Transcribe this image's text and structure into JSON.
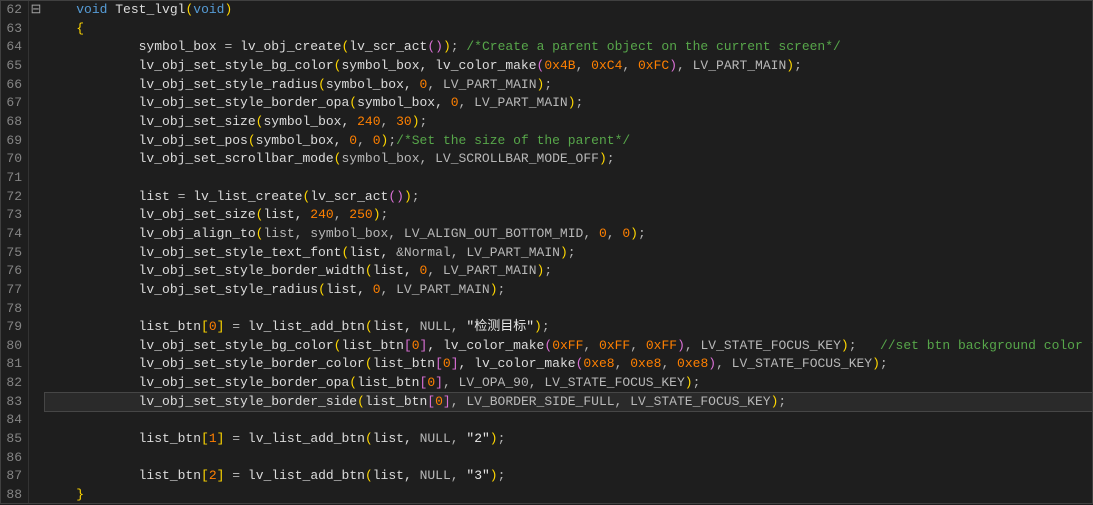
{
  "gutter": {
    "start": 62,
    "end": 88
  },
  "fold": {
    "marker_line": 62,
    "marker": "⊟"
  },
  "highlight_line": 83,
  "code_lines": [
    {
      "n": 62,
      "indent": 1,
      "tokens": [
        {
          "t": "void",
          "c": "kw"
        },
        {
          "t": " Test_lvgl",
          "c": "fn"
        },
        {
          "t": "(",
          "c": "p"
        },
        {
          "t": "void",
          "c": "kw"
        },
        {
          "t": ")",
          "c": "p"
        }
      ]
    },
    {
      "n": 63,
      "indent": 1,
      "tokens": [
        {
          "t": "{",
          "c": "p"
        }
      ]
    },
    {
      "n": 64,
      "indent": 3,
      "tokens": [
        {
          "t": "symbol_box ",
          "c": "id"
        },
        {
          "t": "=",
          "c": "op"
        },
        {
          "t": " lv_obj_create",
          "c": "fn"
        },
        {
          "t": "(",
          "c": "p"
        },
        {
          "t": "lv_scr_act",
          "c": "fn"
        },
        {
          "t": "(",
          "c": "p2"
        },
        {
          "t": ")",
          "c": "p2"
        },
        {
          "t": ")",
          "c": "p"
        },
        {
          "t": "; ",
          "c": "op"
        },
        {
          "t": "/*Create a parent object on the current screen*/",
          "c": "cmt"
        }
      ]
    },
    {
      "n": 65,
      "indent": 3,
      "tokens": [
        {
          "t": "lv_obj_set_style_bg_color",
          "c": "fn"
        },
        {
          "t": "(",
          "c": "p"
        },
        {
          "t": "symbol_box, ",
          "c": "id"
        },
        {
          "t": "lv_color_make",
          "c": "fn"
        },
        {
          "t": "(",
          "c": "p2"
        },
        {
          "t": "0x4B",
          "c": "num"
        },
        {
          "t": ", ",
          "c": "op"
        },
        {
          "t": "0xC4",
          "c": "num"
        },
        {
          "t": ", ",
          "c": "op"
        },
        {
          "t": "0xFC",
          "c": "num"
        },
        {
          "t": ")",
          "c": "p2"
        },
        {
          "t": ", LV_PART_MAIN",
          "c": "mac"
        },
        {
          "t": ")",
          "c": "p"
        },
        {
          "t": ";",
          "c": "op"
        }
      ]
    },
    {
      "n": 66,
      "indent": 3,
      "tokens": [
        {
          "t": "lv_obj_set_style_radius",
          "c": "fn"
        },
        {
          "t": "(",
          "c": "p"
        },
        {
          "t": "symbol_box, ",
          "c": "id"
        },
        {
          "t": "0",
          "c": "num"
        },
        {
          "t": ", LV_PART_MAIN",
          "c": "mac"
        },
        {
          "t": ")",
          "c": "p"
        },
        {
          "t": ";",
          "c": "op"
        }
      ]
    },
    {
      "n": 67,
      "indent": 3,
      "tokens": [
        {
          "t": "lv_obj_set_style_border_opa",
          "c": "fn"
        },
        {
          "t": "(",
          "c": "p"
        },
        {
          "t": "symbol_box, ",
          "c": "id"
        },
        {
          "t": "0",
          "c": "num"
        },
        {
          "t": ", LV_PART_MAIN",
          "c": "mac"
        },
        {
          "t": ")",
          "c": "p"
        },
        {
          "t": ";",
          "c": "op"
        }
      ]
    },
    {
      "n": 68,
      "indent": 3,
      "tokens": [
        {
          "t": "lv_obj_set_size",
          "c": "fn"
        },
        {
          "t": "(",
          "c": "p"
        },
        {
          "t": "symbol_box, ",
          "c": "id"
        },
        {
          "t": "240",
          "c": "num"
        },
        {
          "t": ", ",
          "c": "op"
        },
        {
          "t": "30",
          "c": "num"
        },
        {
          "t": ")",
          "c": "p"
        },
        {
          "t": ";",
          "c": "op"
        }
      ]
    },
    {
      "n": 69,
      "indent": 3,
      "tokens": [
        {
          "t": "lv_obj_set_pos",
          "c": "fn"
        },
        {
          "t": "(",
          "c": "p"
        },
        {
          "t": "symbol_box, ",
          "c": "id"
        },
        {
          "t": "0",
          "c": "num"
        },
        {
          "t": ", ",
          "c": "op"
        },
        {
          "t": "0",
          "c": "num"
        },
        {
          "t": ")",
          "c": "p"
        },
        {
          "t": ";",
          "c": "op"
        },
        {
          "t": "/*Set the size of the parent*/",
          "c": "cmt"
        }
      ]
    },
    {
      "n": 70,
      "indent": 3,
      "tokens": [
        {
          "t": "lv_obj_set_scrollbar_mode",
          "c": "fn"
        },
        {
          "t": "(",
          "c": "p"
        },
        {
          "t": "symbol_box, LV_SCROLLBAR_MODE_OFF",
          "c": "mac"
        },
        {
          "t": ")",
          "c": "p"
        },
        {
          "t": ";",
          "c": "op"
        }
      ]
    },
    {
      "n": 71,
      "indent": 0,
      "tokens": []
    },
    {
      "n": 72,
      "indent": 3,
      "tokens": [
        {
          "t": "list ",
          "c": "id"
        },
        {
          "t": "=",
          "c": "op"
        },
        {
          "t": " lv_list_create",
          "c": "fn"
        },
        {
          "t": "(",
          "c": "p"
        },
        {
          "t": "lv_scr_act",
          "c": "fn"
        },
        {
          "t": "(",
          "c": "p2"
        },
        {
          "t": ")",
          "c": "p2"
        },
        {
          "t": ")",
          "c": "p"
        },
        {
          "t": ";",
          "c": "op"
        }
      ]
    },
    {
      "n": 73,
      "indent": 3,
      "tokens": [
        {
          "t": "lv_obj_set_size",
          "c": "fn"
        },
        {
          "t": "(",
          "c": "p"
        },
        {
          "t": "list, ",
          "c": "id"
        },
        {
          "t": "240",
          "c": "num"
        },
        {
          "t": ", ",
          "c": "op"
        },
        {
          "t": "250",
          "c": "num"
        },
        {
          "t": ")",
          "c": "p"
        },
        {
          "t": ";",
          "c": "op"
        }
      ]
    },
    {
      "n": 74,
      "indent": 3,
      "tokens": [
        {
          "t": "lv_obj_align_to",
          "c": "fn"
        },
        {
          "t": "(",
          "c": "p"
        },
        {
          "t": "list, symbol_box, LV_ALIGN_OUT_BOTTOM_MID, ",
          "c": "mac"
        },
        {
          "t": "0",
          "c": "num"
        },
        {
          "t": ", ",
          "c": "op"
        },
        {
          "t": "0",
          "c": "num"
        },
        {
          "t": ")",
          "c": "p"
        },
        {
          "t": ";",
          "c": "op"
        }
      ]
    },
    {
      "n": 75,
      "indent": 3,
      "tokens": [
        {
          "t": "lv_obj_set_style_text_font",
          "c": "fn"
        },
        {
          "t": "(",
          "c": "p"
        },
        {
          "t": "list, ",
          "c": "id"
        },
        {
          "t": "&",
          "c": "op"
        },
        {
          "t": "Normal, LV_PART_MAIN",
          "c": "mac"
        },
        {
          "t": ")",
          "c": "p"
        },
        {
          "t": ";",
          "c": "op"
        }
      ]
    },
    {
      "n": 76,
      "indent": 3,
      "tokens": [
        {
          "t": "lv_obj_set_style_border_width",
          "c": "fn"
        },
        {
          "t": "(",
          "c": "p"
        },
        {
          "t": "list, ",
          "c": "id"
        },
        {
          "t": "0",
          "c": "num"
        },
        {
          "t": ", LV_PART_MAIN",
          "c": "mac"
        },
        {
          "t": ")",
          "c": "p"
        },
        {
          "t": ";",
          "c": "op"
        }
      ]
    },
    {
      "n": 77,
      "indent": 3,
      "tokens": [
        {
          "t": "lv_obj_set_style_radius",
          "c": "fn"
        },
        {
          "t": "(",
          "c": "p"
        },
        {
          "t": "list, ",
          "c": "id"
        },
        {
          "t": "0",
          "c": "num"
        },
        {
          "t": ", LV_PART_MAIN",
          "c": "mac"
        },
        {
          "t": ")",
          "c": "p"
        },
        {
          "t": ";",
          "c": "op"
        }
      ]
    },
    {
      "n": 78,
      "indent": 0,
      "tokens": []
    },
    {
      "n": 79,
      "indent": 3,
      "tokens": [
        {
          "t": "list_btn",
          "c": "id"
        },
        {
          "t": "[",
          "c": "p"
        },
        {
          "t": "0",
          "c": "num"
        },
        {
          "t": "]",
          "c": "p"
        },
        {
          "t": " ",
          "c": "op"
        },
        {
          "t": "=",
          "c": "op"
        },
        {
          "t": " lv_list_add_btn",
          "c": "fn"
        },
        {
          "t": "(",
          "c": "p"
        },
        {
          "t": "list, ",
          "c": "id"
        },
        {
          "t": "NULL",
          "c": "mac"
        },
        {
          "t": ", ",
          "c": "op"
        },
        {
          "t": "\"检测目标\"",
          "c": "str"
        },
        {
          "t": ")",
          "c": "p"
        },
        {
          "t": ";",
          "c": "op"
        }
      ]
    },
    {
      "n": 80,
      "indent": 3,
      "tokens": [
        {
          "t": "lv_obj_set_style_bg_color",
          "c": "fn"
        },
        {
          "t": "(",
          "c": "p"
        },
        {
          "t": "list_btn",
          "c": "id"
        },
        {
          "t": "[",
          "c": "p2"
        },
        {
          "t": "0",
          "c": "num"
        },
        {
          "t": "]",
          "c": "p2"
        },
        {
          "t": ", lv_color_make",
          "c": "fn"
        },
        {
          "t": "(",
          "c": "p2"
        },
        {
          "t": "0xFF",
          "c": "num"
        },
        {
          "t": ", ",
          "c": "op"
        },
        {
          "t": "0xFF",
          "c": "num"
        },
        {
          "t": ", ",
          "c": "op"
        },
        {
          "t": "0xFF",
          "c": "num"
        },
        {
          "t": ")",
          "c": "p2"
        },
        {
          "t": ", LV_STATE_FOCUS_KEY",
          "c": "mac"
        },
        {
          "t": ")",
          "c": "p"
        },
        {
          "t": ";   ",
          "c": "op"
        },
        {
          "t": "//set btn background color to white",
          "c": "cmt"
        }
      ]
    },
    {
      "n": 81,
      "indent": 3,
      "tokens": [
        {
          "t": "lv_obj_set_style_border_color",
          "c": "fn"
        },
        {
          "t": "(",
          "c": "p"
        },
        {
          "t": "list_btn",
          "c": "id"
        },
        {
          "t": "[",
          "c": "p2"
        },
        {
          "t": "0",
          "c": "num"
        },
        {
          "t": "]",
          "c": "p2"
        },
        {
          "t": ", lv_color_make",
          "c": "fn"
        },
        {
          "t": "(",
          "c": "p2"
        },
        {
          "t": "0xe8",
          "c": "num"
        },
        {
          "t": ", ",
          "c": "op"
        },
        {
          "t": "0xe8",
          "c": "num"
        },
        {
          "t": ", ",
          "c": "op"
        },
        {
          "t": "0xe8",
          "c": "num"
        },
        {
          "t": ")",
          "c": "p2"
        },
        {
          "t": ", LV_STATE_FOCUS_KEY",
          "c": "mac"
        },
        {
          "t": ")",
          "c": "p"
        },
        {
          "t": ";",
          "c": "op"
        }
      ]
    },
    {
      "n": 82,
      "indent": 3,
      "tokens": [
        {
          "t": "lv_obj_set_style_border_opa",
          "c": "fn"
        },
        {
          "t": "(",
          "c": "p"
        },
        {
          "t": "list_btn",
          "c": "id"
        },
        {
          "t": "[",
          "c": "p2"
        },
        {
          "t": "0",
          "c": "num"
        },
        {
          "t": "]",
          "c": "p2"
        },
        {
          "t": ", LV_OPA_90, LV_STATE_FOCUS_KEY",
          "c": "mac"
        },
        {
          "t": ")",
          "c": "p"
        },
        {
          "t": ";",
          "c": "op"
        }
      ]
    },
    {
      "n": 83,
      "indent": 3,
      "tokens": [
        {
          "t": "lv_obj_set_style_border_side",
          "c": "fn"
        },
        {
          "t": "(",
          "c": "p"
        },
        {
          "t": "list_btn",
          "c": "id"
        },
        {
          "t": "[",
          "c": "p2"
        },
        {
          "t": "0",
          "c": "num"
        },
        {
          "t": "]",
          "c": "p2"
        },
        {
          "t": ", LV_BORDER_SIDE_FULL, LV_STATE_FOCUS_KEY",
          "c": "mac"
        },
        {
          "t": ")",
          "c": "p"
        },
        {
          "t": ";",
          "c": "op"
        }
      ]
    },
    {
      "n": 84,
      "indent": 0,
      "tokens": []
    },
    {
      "n": 85,
      "indent": 3,
      "tokens": [
        {
          "t": "list_btn",
          "c": "id"
        },
        {
          "t": "[",
          "c": "p"
        },
        {
          "t": "1",
          "c": "num"
        },
        {
          "t": "]",
          "c": "p"
        },
        {
          "t": " ",
          "c": "op"
        },
        {
          "t": "=",
          "c": "op"
        },
        {
          "t": " lv_list_add_btn",
          "c": "fn"
        },
        {
          "t": "(",
          "c": "p"
        },
        {
          "t": "list, ",
          "c": "id"
        },
        {
          "t": "NULL",
          "c": "mac"
        },
        {
          "t": ", ",
          "c": "op"
        },
        {
          "t": "\"2\"",
          "c": "str"
        },
        {
          "t": ")",
          "c": "p"
        },
        {
          "t": ";",
          "c": "op"
        }
      ]
    },
    {
      "n": 86,
      "indent": 0,
      "tokens": []
    },
    {
      "n": 87,
      "indent": 3,
      "tokens": [
        {
          "t": "list_btn",
          "c": "id"
        },
        {
          "t": "[",
          "c": "p"
        },
        {
          "t": "2",
          "c": "num"
        },
        {
          "t": "]",
          "c": "p"
        },
        {
          "t": " ",
          "c": "op"
        },
        {
          "t": "=",
          "c": "op"
        },
        {
          "t": " lv_list_add_btn",
          "c": "fn"
        },
        {
          "t": "(",
          "c": "p"
        },
        {
          "t": "list, ",
          "c": "id"
        },
        {
          "t": "NULL",
          "c": "mac"
        },
        {
          "t": ", ",
          "c": "op"
        },
        {
          "t": "\"3\"",
          "c": "str"
        },
        {
          "t": ")",
          "c": "p"
        },
        {
          "t": ";",
          "c": "op"
        }
      ]
    },
    {
      "n": 88,
      "indent": 1,
      "tokens": [
        {
          "t": "}",
          "c": "p"
        }
      ]
    }
  ]
}
